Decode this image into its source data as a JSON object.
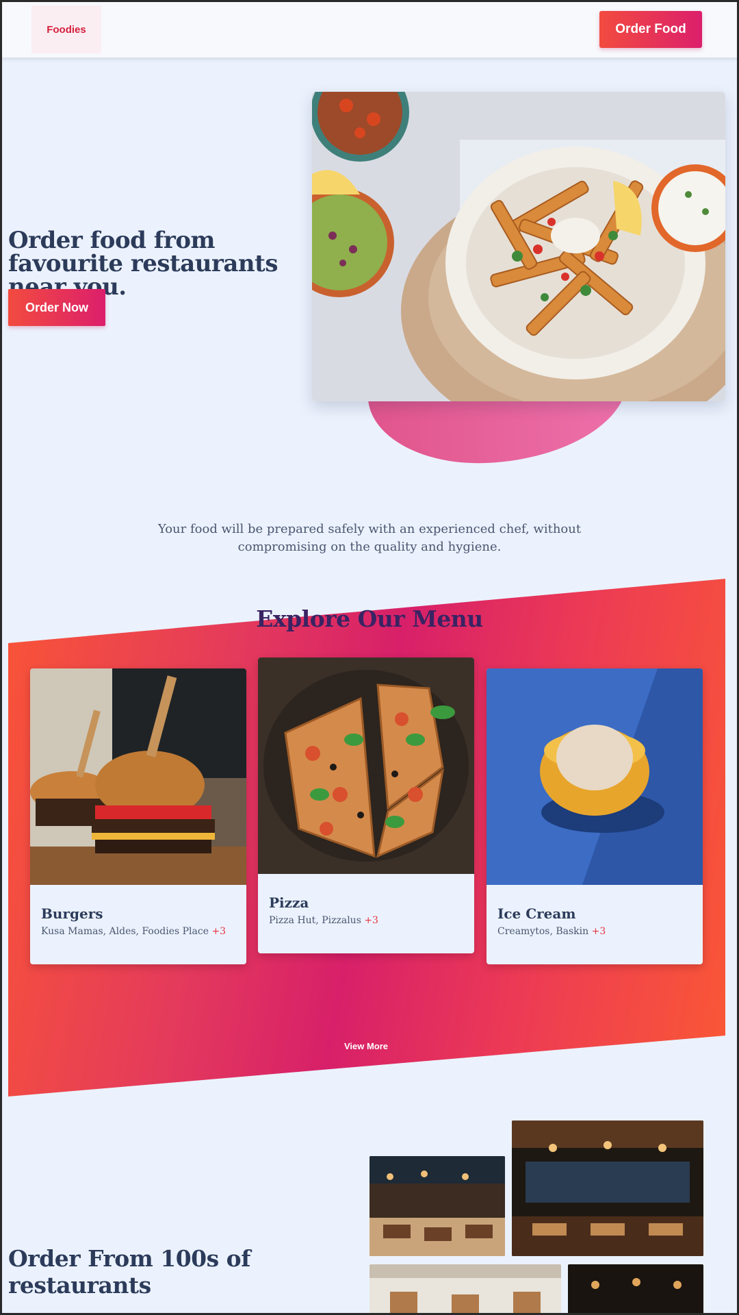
{
  "header": {
    "logo_text": "Foodies",
    "cta_label": "Order Food"
  },
  "hero": {
    "title": "Order food from favourite restaurants near you.",
    "cta_label": "Order Now",
    "image_alt": "fries-bowl-photo"
  },
  "tagline": "Your food will be prepared safely with an experienced chef, without compromising on the quality and hygiene.",
  "menu": {
    "title": "Explore Our Menu",
    "items": [
      {
        "name": "Burgers",
        "restaurants": "Kusa Mamas, Aldes, Foodies Place",
        "more": "+3"
      },
      {
        "name": "Pizza",
        "restaurants": "Pizza Hut, Pizzalus",
        "more": "+3"
      },
      {
        "name": "Ice Cream",
        "restaurants": "Creamytos, Baskin",
        "more": "+3"
      }
    ],
    "view_more_label": "View More"
  },
  "restaurants": {
    "title": "Order From 100s of restaurants"
  },
  "colors": {
    "background": "#ebf2fd",
    "accent_start": "#f24b3f",
    "accent_end": "#dc1f6c",
    "heading": "#2c3b5a",
    "menu_title": "#3a2363"
  }
}
